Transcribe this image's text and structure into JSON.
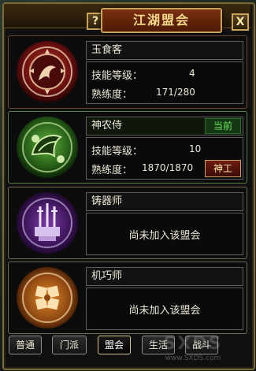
{
  "window": {
    "title": "江湖盟会",
    "help_label": "?",
    "close_label": "X"
  },
  "cards": [
    {
      "name": "玉食客",
      "skill_level_label": "技能等级：",
      "skill_level": "4",
      "proficiency_label": "熟练度：",
      "proficiency": "171/280",
      "emblem": "wreath-dragon-emblem",
      "theme_color": "#8b1a1a"
    },
    {
      "name": "神农侍",
      "current_badge": "当前",
      "skill_level_label": "技能等级：",
      "skill_level": "10",
      "proficiency_label": "熟练度：",
      "proficiency": "1870/1870",
      "action_button": "神工",
      "emblem": "leaf-vine-emblem",
      "theme_color": "#2f6a22"
    },
    {
      "name": "铸器师",
      "status": "尚未加入该盟会",
      "emblem": "forge-swords-emblem",
      "theme_color": "#5b2a7a"
    },
    {
      "name": "机巧师",
      "status": "尚未加入该盟会",
      "emblem": "mechanism-gear-emblem",
      "theme_color": "#b8641a"
    }
  ],
  "tabs": [
    {
      "label": "普通",
      "active": false
    },
    {
      "label": "门派",
      "active": false
    },
    {
      "label": "盟会",
      "active": true
    },
    {
      "label": "生活",
      "active": false
    },
    {
      "label": "战斗",
      "active": false
    }
  ],
  "watermark": {
    "text": "www.SXDS.com"
  }
}
